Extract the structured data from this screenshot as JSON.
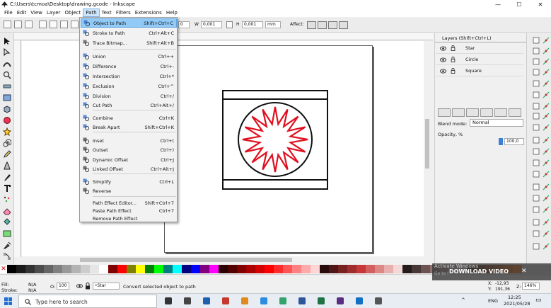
{
  "window": {
    "title": "C:\\Users\\tcmoa\\Desktop\\drawing.gcode - Inkscape",
    "minimize_glyph": "—",
    "maximize_glyph": "☐",
    "close_glyph": "✕"
  },
  "menubar": {
    "items": [
      "File",
      "Edit",
      "View",
      "Layer",
      "Object",
      "Path",
      "Text",
      "Filters",
      "Extensions",
      "Help"
    ],
    "active": "Path"
  },
  "toolbar": {
    "field_value_1": "0",
    "w_label": "W",
    "w_value": "0,001",
    "h_label": "H",
    "h_value": "0,001",
    "unit": "mm",
    "affect_label": "Affect:"
  },
  "path_menu": {
    "items": [
      {
        "label": "Object to Path",
        "shortcut": "Shift+Ctrl+C",
        "icon": "object-to-path-icon",
        "highlighted": true
      },
      {
        "label": "Stroke to Path",
        "shortcut": "Ctrl+Alt+C",
        "icon": "stroke-to-path-icon"
      },
      {
        "label": "Trace Bitmap...",
        "shortcut": "Shift+Alt+B",
        "icon": "trace-bitmap-icon"
      },
      {
        "label": "Union",
        "shortcut": "Ctrl++",
        "icon": "union-icon"
      },
      {
        "label": "Difference",
        "shortcut": "Ctrl+-",
        "icon": "difference-icon"
      },
      {
        "label": "Intersection",
        "shortcut": "Ctrl+*",
        "icon": "intersection-icon"
      },
      {
        "label": "Exclusion",
        "shortcut": "Ctrl+^",
        "icon": "exclusion-icon"
      },
      {
        "label": "Division",
        "shortcut": "Ctrl+/",
        "icon": "division-icon"
      },
      {
        "label": "Cut Path",
        "shortcut": "Ctrl+Alt+/",
        "icon": "cut-path-icon"
      },
      {
        "label": "Combine",
        "shortcut": "Ctrl+K",
        "icon": "combine-icon"
      },
      {
        "label": "Break Apart",
        "shortcut": "Shift+Ctrl+K",
        "icon": "break-apart-icon"
      },
      {
        "label": "Inset",
        "shortcut": "Ctrl+(",
        "icon": "inset-icon"
      },
      {
        "label": "Outset",
        "shortcut": "Ctrl+)",
        "icon": "outset-icon"
      },
      {
        "label": "Dynamic Offset",
        "shortcut": "Ctrl+J",
        "icon": "dynamic-offset-icon"
      },
      {
        "label": "Linked Offset",
        "shortcut": "Ctrl+Alt+J",
        "icon": "linked-offset-icon"
      },
      {
        "label": "Simplify",
        "shortcut": "Ctrl+L",
        "icon": "simplify-icon"
      },
      {
        "label": "Reverse",
        "shortcut": "",
        "icon": "reverse-icon"
      },
      {
        "label": "Path Effect Editor...",
        "shortcut": "Shift+Ctrl+7",
        "icon": ""
      },
      {
        "label": "Paste Path Effect",
        "shortcut": "Ctrl+7",
        "icon": ""
      },
      {
        "label": "Remove Path Effect",
        "shortcut": "",
        "icon": ""
      }
    ]
  },
  "layers_panel": {
    "title": "Layers (Shift+Ctrl+L)",
    "layers": [
      "Star",
      "Circle",
      "Square"
    ],
    "blend_label": "Blend mode:",
    "blend_value": "Normal",
    "opacity_label": "Opacity, %",
    "opacity_value": "100,0",
    "opacity_fraction": 1.0
  },
  "palette": {
    "none_glyph": "✕",
    "colors": [
      "#000000",
      "#1a1a1a",
      "#333333",
      "#4d4d4d",
      "#666666",
      "#808080",
      "#999999",
      "#b3b3b3",
      "#cccccc",
      "#e6e6e6",
      "#ffffff",
      "#800000",
      "#ff0000",
      "#808000",
      "#ffff00",
      "#008000",
      "#00ff00",
      "#008080",
      "#00ffff",
      "#000080",
      "#0000ff",
      "#800080",
      "#ff00ff",
      "#2b0000",
      "#550000",
      "#800000",
      "#aa0000",
      "#d40000",
      "#ff0000",
      "#ff2a2a",
      "#ff5555",
      "#ff8080",
      "#ffaaaa",
      "#ffd5d5",
      "#280b0b",
      "#501616",
      "#782121",
      "#a02c2c",
      "#c83737",
      "#d35f5f",
      "#de8787",
      "#e9afaf",
      "#f4d7d7",
      "#241c1c",
      "#483737",
      "#6c5353",
      "#916f6f",
      "#ac9393",
      "#c8b7b7",
      "#e3dbdb",
      "#2b1100",
      "#552200",
      "#803300",
      "#aa4400",
      "#d45500",
      "#ff6600"
    ]
  },
  "status": {
    "fill_label": "Fill:",
    "fill_value": "N/A",
    "stroke_label": "Stroke:",
    "stroke_value": "N/A",
    "o_label": "O:",
    "o_value": "100",
    "layer_value": "•Star",
    "message": "Convert selected object to path",
    "x_label": "X:",
    "x_value": "-12,93",
    "y_label": "Y:",
    "y_value": "191,36",
    "zoom_label": "Z:",
    "zoom_value": "146%"
  },
  "overlay": {
    "activate_line1": "Activate Windows",
    "activate_line2": "Go to Settings to activate Windows.",
    "download_label": "DOWNLOAD VIDEO",
    "close_glyph": "✕"
  },
  "taskbar": {
    "search_placeholder": "Type here to search",
    "time": "12:25",
    "date": "2021/05/28",
    "lang": "ENG",
    "tray_up_glyph": "^",
    "notif_glyph": "▭"
  },
  "drawing": {
    "star_color": "#e01020",
    "star_points": 16
  }
}
